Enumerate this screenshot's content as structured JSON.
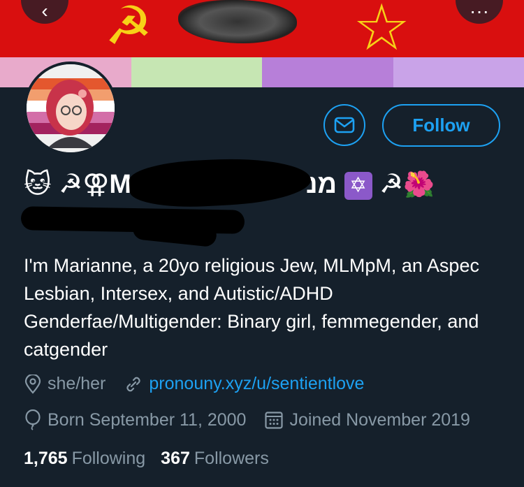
{
  "profile": {
    "bio": "I'm Marianne, a 20yo religious Jew, MLMpM, an Aspec Lesbian, Intersex, and Autistic/ADHD Genderfae/Multigender: Binary girl, femmegender, and catgender",
    "pronouns": "she/her",
    "website": "pronouny.xyz/u/sentientlove",
    "born": "Born September 11, 2000",
    "joined": "Joined November 2019",
    "name_prefix": "🐱 ☭⚢M",
    "name_suffix": "מנ",
    "name_emoji_star": "✡",
    "name_hammer": "☭",
    "name_hibiscus": "🌺"
  },
  "actions": {
    "follow_label": "Follow",
    "back_icon": "back-arrow-icon",
    "more_icon": "more-icon",
    "message_icon": "mail-icon"
  },
  "stats": {
    "following_count": "1,765",
    "following_label": "Following",
    "followers_count": "367",
    "followers_label": "Followers"
  },
  "colors": {
    "background": "#15202b",
    "accent": "#1da1f2",
    "secondary_text": "#8899a6",
    "banner_red": "#d90f0f",
    "banner_gold": "#f7d117"
  }
}
